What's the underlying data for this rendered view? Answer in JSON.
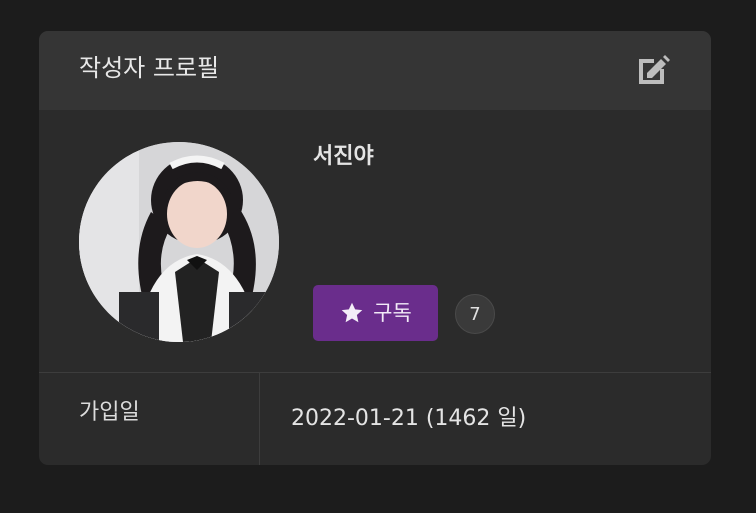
{
  "card": {
    "title": "작성자 프로필",
    "edit_icon": "edit-icon"
  },
  "profile": {
    "nickname": "서진야",
    "avatar": "avatar-photo",
    "subscribe_label": "구독",
    "subscribe_icon": "star-icon",
    "subscriber_count": "7",
    "accent_color": "#6a2d8c"
  },
  "info": {
    "join_label": "가입일",
    "join_value": "2022-01-21 (1462 일)"
  }
}
